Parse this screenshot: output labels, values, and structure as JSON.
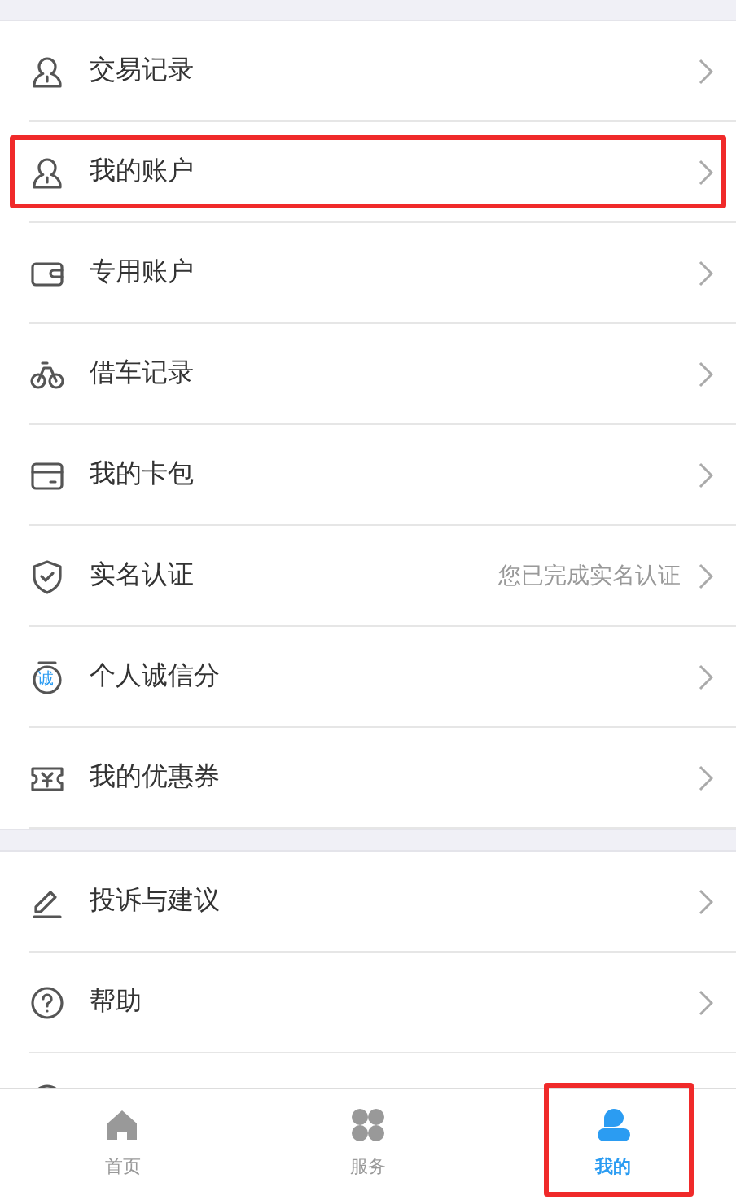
{
  "sections": [
    {
      "items": [
        {
          "label": "交易记录",
          "highlighted": false
        },
        {
          "label": "我的账户",
          "highlighted": true
        },
        {
          "label": "专用账户",
          "highlighted": false
        },
        {
          "label": "借车记录",
          "highlighted": false
        },
        {
          "label": "我的卡包",
          "highlighted": false
        },
        {
          "label": "实名认证",
          "value": "您已完成实名认证",
          "highlighted": false
        },
        {
          "label": "个人诚信分",
          "badge": "诚",
          "highlighted": false
        },
        {
          "label": "我的优惠券",
          "highlighted": false
        }
      ]
    },
    {
      "items": [
        {
          "label": "投诉与建议",
          "highlighted": false
        },
        {
          "label": "帮助",
          "highlighted": false
        },
        {
          "highlighted": false
        }
      ]
    }
  ],
  "tabbar": [
    {
      "label": "首页",
      "selected": false,
      "highlighted": false
    },
    {
      "label": "服务",
      "selected": false,
      "highlighted": false
    },
    {
      "label": "我的",
      "selected": true,
      "highlighted": true
    }
  ]
}
